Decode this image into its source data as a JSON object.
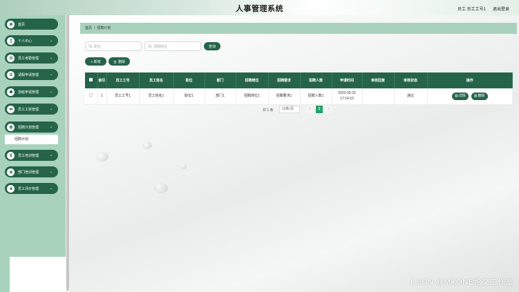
{
  "header": {
    "title": "人事管理系统",
    "user": "员工 员工工号1",
    "logout": "退出登录"
  },
  "sidebar": {
    "items": [
      {
        "label": "首页",
        "icon": "home-icon",
        "has_arrow": false
      },
      {
        "label": "个人中心",
        "icon": "user-icon",
        "has_arrow": true
      },
      {
        "label": "员工考勤管理",
        "icon": "fingerprint-icon",
        "has_arrow": true
      },
      {
        "label": "请假申请管理",
        "icon": "list-icon",
        "has_arrow": true
      },
      {
        "label": "加班申请管理",
        "icon": "briefcase-icon",
        "has_arrow": true
      },
      {
        "label": "员工工资管理",
        "icon": "money-icon",
        "has_arrow": true
      },
      {
        "label": "招聘计划管理",
        "icon": "plan-icon",
        "has_arrow": true
      },
      {
        "label": "员工培训管理",
        "icon": "person-icon",
        "has_arrow": true
      },
      {
        "label": "部门培训管理",
        "icon": "group-icon",
        "has_arrow": true
      },
      {
        "label": "员工评价管理",
        "icon": "star-icon",
        "has_arrow": true
      }
    ],
    "submenu_item": "招聘计划"
  },
  "breadcrumb": {
    "home": "首页",
    "separator": "/",
    "current": "招聘计划"
  },
  "search": {
    "field1_placeholder": "职位",
    "field2_placeholder": "招聘岗位",
    "button": "查询"
  },
  "actions": {
    "add": "+ 新增",
    "delete": "删除"
  },
  "table": {
    "headers": [
      "索引",
      "员工工号",
      "员工姓名",
      "职位",
      "部门",
      "招聘岗位",
      "招聘要求",
      "招聘人数",
      "申请时间",
      "审核回复",
      "审核状态",
      "操作"
    ],
    "rows": [
      {
        "index": "1",
        "emp_no": "员工工号1",
        "emp_name": "员工姓名1",
        "position": "职位1",
        "department": "部门1",
        "post": "招聘岗位1",
        "requirement": "招聘要求1",
        "headcount": "招聘人数1",
        "apply_time": "2022-03-22 17:14:10",
        "reply": "",
        "status": "通过",
        "detail_btn": "详情",
        "delete_btn": "删除"
      }
    ]
  },
  "pagination": {
    "total": "共 1 条",
    "page_size": "10条/页",
    "prev": "‹",
    "current": "1",
    "next": "›"
  },
  "watermark": "CSDN @MKONE论文工作室",
  "colors": {
    "primary": "#26644a",
    "sidebar_bg": "#a9d2bd",
    "page_active": "#26a26b"
  }
}
